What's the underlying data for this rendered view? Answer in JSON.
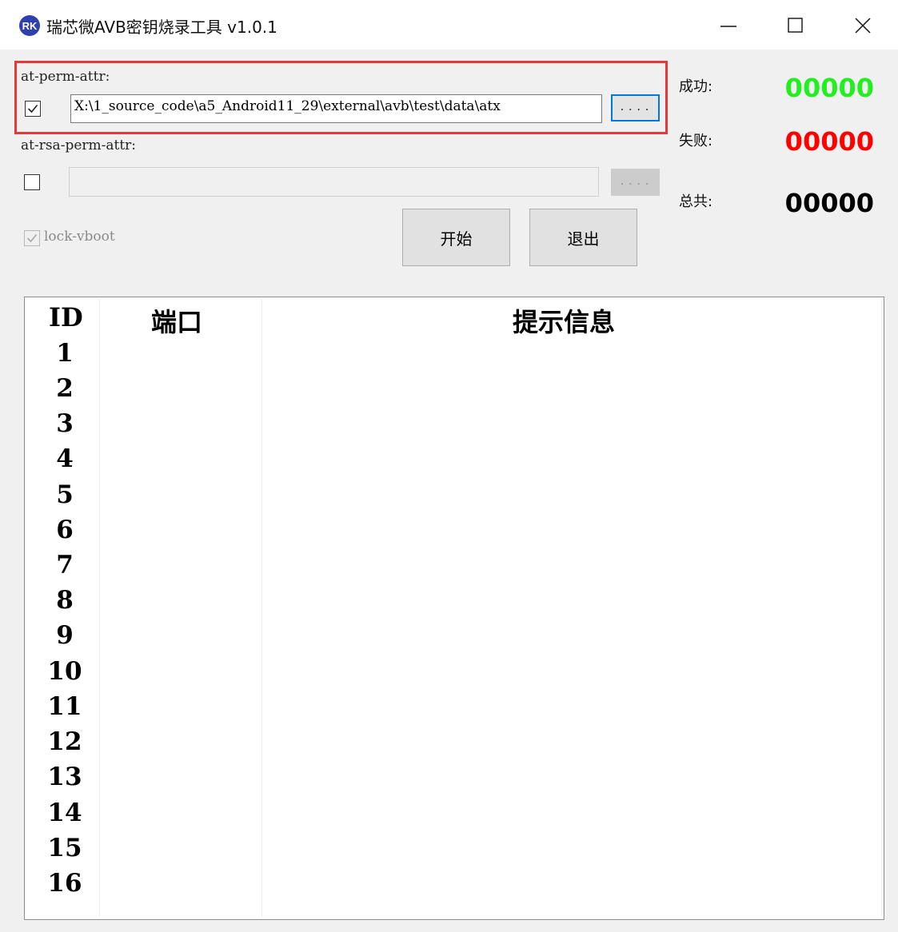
{
  "window": {
    "logo_text": "RK",
    "title": "瑞芯微AVB密钥烧录工具 v1.0.1"
  },
  "perm_attr": {
    "label": "at-perm-attr:",
    "checked": true,
    "path": "X:\\1_source_code\\a5_Android11_29\\external\\avb\\test\\data\\atx",
    "browse_label": "...."
  },
  "rsa_perm_attr": {
    "label": "at-rsa-perm-attr:",
    "checked": false,
    "path": "",
    "browse_label": "...."
  },
  "lock_vboot": {
    "label": "lock-vboot",
    "checked": true,
    "disabled": true
  },
  "buttons": {
    "start": "开始",
    "exit": "退出"
  },
  "stats": {
    "success_label": "成功:",
    "success_value": "00000",
    "fail_label": "失败:",
    "fail_value": "00000",
    "total_label": "总共:",
    "total_value": "00000"
  },
  "colors": {
    "success": "#22ee22",
    "fail": "#ff0000",
    "total": "#000000",
    "highlight": "#e5383b",
    "focus": "#0078d7"
  },
  "icons": {
    "minimize": "minimize-icon",
    "maximize": "maximize-icon",
    "close": "close-icon"
  },
  "table": {
    "headers": [
      "ID",
      "端口",
      "提示信息"
    ],
    "rows": [
      {
        "id": "1",
        "port": "",
        "info": ""
      },
      {
        "id": "2",
        "port": "",
        "info": ""
      },
      {
        "id": "3",
        "port": "",
        "info": ""
      },
      {
        "id": "4",
        "port": "",
        "info": ""
      },
      {
        "id": "5",
        "port": "",
        "info": ""
      },
      {
        "id": "6",
        "port": "",
        "info": ""
      },
      {
        "id": "7",
        "port": "",
        "info": ""
      },
      {
        "id": "8",
        "port": "",
        "info": ""
      },
      {
        "id": "9",
        "port": "",
        "info": ""
      },
      {
        "id": "10",
        "port": "",
        "info": ""
      },
      {
        "id": "11",
        "port": "",
        "info": ""
      },
      {
        "id": "12",
        "port": "",
        "info": ""
      },
      {
        "id": "13",
        "port": "",
        "info": ""
      },
      {
        "id": "14",
        "port": "",
        "info": ""
      },
      {
        "id": "15",
        "port": "",
        "info": ""
      },
      {
        "id": "16",
        "port": "",
        "info": ""
      }
    ]
  }
}
